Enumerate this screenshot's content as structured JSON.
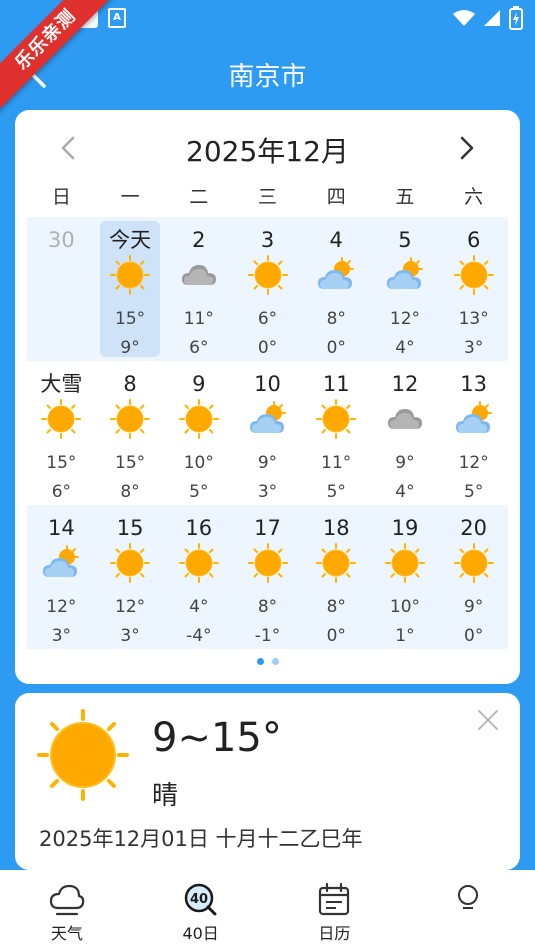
{
  "status_bar": {
    "ribbon_text": "乐乐亲测",
    "a_badge": "A",
    "battery_glyph": "⚡"
  },
  "header": {
    "title": "南京市"
  },
  "calendar": {
    "month_title": "2025年12月",
    "weekdays": [
      "日",
      "一",
      "二",
      "三",
      "四",
      "五",
      "六"
    ],
    "weeks": [
      [
        {
          "label": "30",
          "icon": "",
          "high": "",
          "low": "",
          "state": "other"
        },
        {
          "label": "今天",
          "icon": "sun-icon",
          "high": "15°",
          "low": "9°",
          "state": "today"
        },
        {
          "label": "2",
          "icon": "cloudy-icon",
          "high": "11°",
          "low": "6°",
          "state": ""
        },
        {
          "label": "3",
          "icon": "sun-icon",
          "high": "6°",
          "low": "0°",
          "state": ""
        },
        {
          "label": "4",
          "icon": "partly-cloudy-icon",
          "high": "8°",
          "low": "0°",
          "state": ""
        },
        {
          "label": "5",
          "icon": "partly-cloudy-icon",
          "high": "12°",
          "low": "4°",
          "state": ""
        },
        {
          "label": "6",
          "icon": "sun-icon",
          "high": "13°",
          "low": "3°",
          "state": ""
        }
      ],
      [
        {
          "label": "大雪",
          "icon": "sun-icon",
          "high": "15°",
          "low": "6°",
          "state": ""
        },
        {
          "label": "8",
          "icon": "sun-icon",
          "high": "15°",
          "low": "8°",
          "state": ""
        },
        {
          "label": "9",
          "icon": "sun-icon",
          "high": "10°",
          "low": "5°",
          "state": ""
        },
        {
          "label": "10",
          "icon": "partly-cloudy-icon",
          "high": "9°",
          "low": "3°",
          "state": ""
        },
        {
          "label": "11",
          "icon": "sun-icon",
          "high": "11°",
          "low": "5°",
          "state": ""
        },
        {
          "label": "12",
          "icon": "cloudy-icon",
          "high": "9°",
          "low": "4°",
          "state": ""
        },
        {
          "label": "13",
          "icon": "partly-cloudy-icon",
          "high": "12°",
          "low": "5°",
          "state": ""
        }
      ],
      [
        {
          "label": "14",
          "icon": "partly-cloudy-icon",
          "high": "12°",
          "low": "3°",
          "state": ""
        },
        {
          "label": "15",
          "icon": "sun-icon",
          "high": "12°",
          "low": "3°",
          "state": ""
        },
        {
          "label": "16",
          "icon": "sun-icon",
          "high": "4°",
          "low": "-4°",
          "state": ""
        },
        {
          "label": "17",
          "icon": "sun-icon",
          "high": "8°",
          "low": "-1°",
          "state": ""
        },
        {
          "label": "18",
          "icon": "sun-icon",
          "high": "8°",
          "low": "0°",
          "state": ""
        },
        {
          "label": "19",
          "icon": "sun-icon",
          "high": "10°",
          "low": "1°",
          "state": ""
        },
        {
          "label": "20",
          "icon": "sun-icon",
          "high": "9°",
          "low": "0°",
          "state": ""
        }
      ]
    ],
    "page_dots": 2,
    "active_dot": 0
  },
  "detail": {
    "temp_range": "9~15°",
    "condition": "晴",
    "date_line": "2025年12月01日   十月十二乙巳年"
  },
  "bottom_nav": [
    {
      "label": "天气",
      "icon": "cloud-weather-icon"
    },
    {
      "label": "40日",
      "icon": "forty-day-icon",
      "badge": "40"
    },
    {
      "label": "日历",
      "icon": "calendar-icon"
    },
    {
      "label": "",
      "icon": "bulb-icon"
    }
  ],
  "colors": {
    "primary": "#2e9bf2",
    "today_bg": "#cfe3f8",
    "row_alt": "#edf6fe",
    "sun": "#ffb300"
  }
}
